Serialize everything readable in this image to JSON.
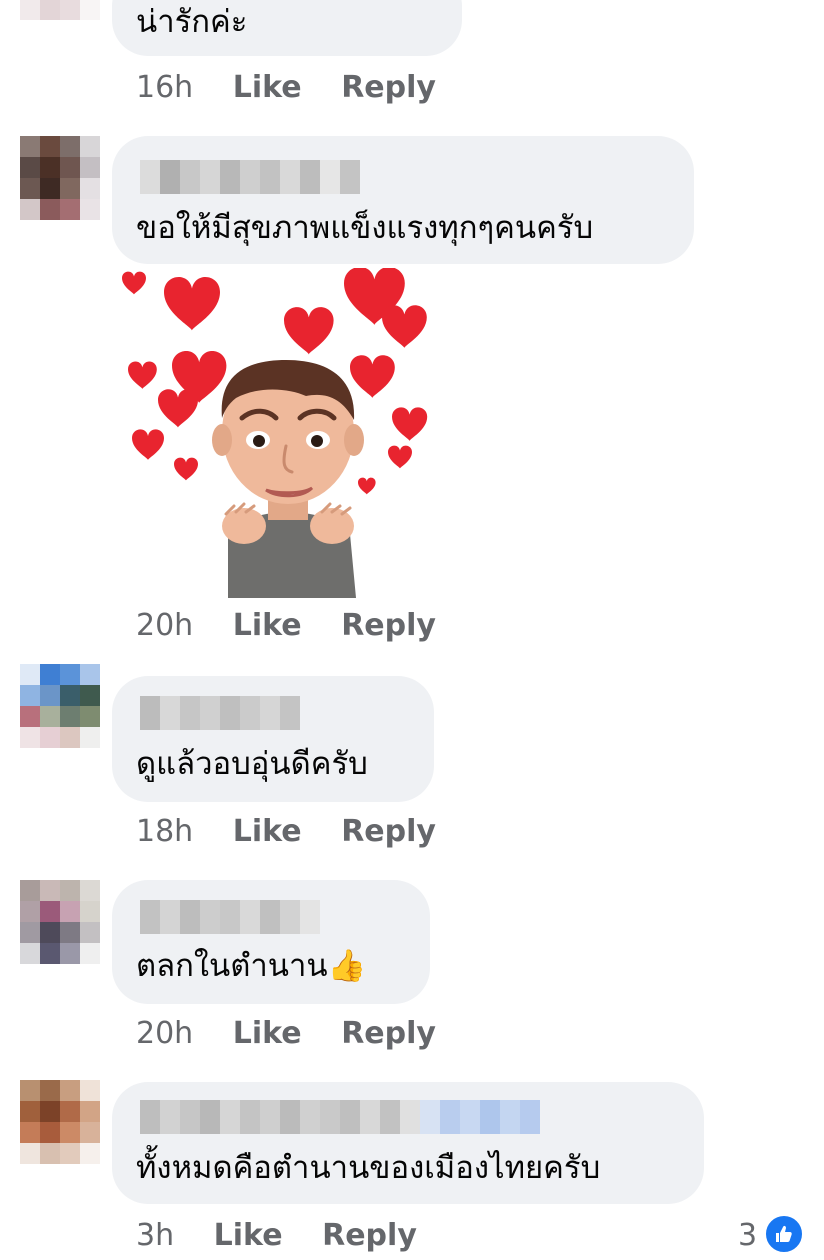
{
  "comments": [
    {
      "text": "น่ารักค่ะ",
      "time": "16h",
      "like": "Like",
      "reply": "Reply"
    },
    {
      "text": "ขอให้มีสุขภาพแข็งแรงทุกๆคนครับ",
      "time": "20h",
      "like": "Like",
      "reply": "Reply",
      "sticker": "heart-eyes-avatar-sticker"
    },
    {
      "text": "ดูแล้วอบอุ่นดีครับ",
      "time": "18h",
      "like": "Like",
      "reply": "Reply"
    },
    {
      "text": "ตลกในตำนาน",
      "emoji": "👍",
      "time": "20h",
      "like": "Like",
      "reply": "Reply"
    },
    {
      "text": "ทั้งหมดคือตำนานของเมืองไทยครับ",
      "time": "3h",
      "like": "Like",
      "reply": "Reply",
      "reaction_count": "3",
      "reaction_icon": "thumbs-up-icon"
    }
  ],
  "colors": {
    "bubble": "#eff1f4",
    "meta_text": "#65676b",
    "like_blue": "#1877f2",
    "heart_red": "#e8242f"
  }
}
